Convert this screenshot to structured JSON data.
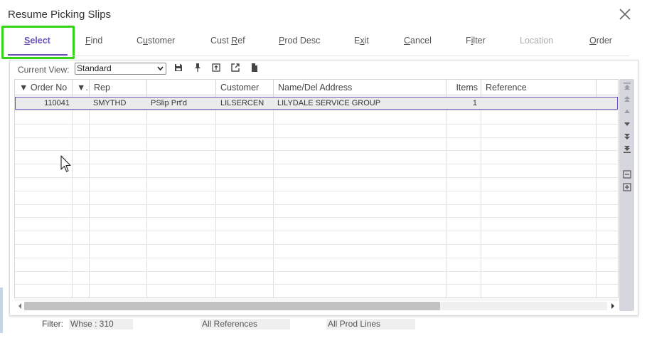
{
  "window": {
    "title": "Resume Picking Slips"
  },
  "toolbar": {
    "buttons": [
      {
        "label": "Select",
        "underline": "S",
        "active": true,
        "enabled": true
      },
      {
        "label": "Find",
        "underline": "F",
        "enabled": true
      },
      {
        "label": "Customer",
        "underline": "u",
        "enabled": true
      },
      {
        "label": "Cust Ref",
        "underline": "R",
        "enabled": true
      },
      {
        "label": "Prod Desc",
        "underline": "P",
        "enabled": true
      },
      {
        "label": "Exit",
        "underline": "x",
        "enabled": true
      },
      {
        "label": "Cancel",
        "underline": "C",
        "enabled": true
      },
      {
        "label": "Filter",
        "underline": "i",
        "enabled": true
      },
      {
        "label": "Location",
        "underline": "",
        "enabled": false
      },
      {
        "label": "Order",
        "underline": "O",
        "enabled": true
      }
    ]
  },
  "view": {
    "label": "Current View:",
    "value": "Standard"
  },
  "view_icons": [
    "save-icon",
    "pin-icon",
    "export-icon",
    "popout-icon",
    "document-icon"
  ],
  "grid": {
    "columns": [
      {
        "key": "order_no",
        "label": "▼ Order No"
      },
      {
        "key": "sort",
        "label": "▼."
      },
      {
        "key": "rep",
        "label": "Rep"
      },
      {
        "key": "status",
        "label": ""
      },
      {
        "key": "customer",
        "label": "Customer"
      },
      {
        "key": "name",
        "label": "Name/Del Address"
      },
      {
        "key": "items",
        "label": "Items"
      },
      {
        "key": "reference",
        "label": "Reference"
      },
      {
        "key": "extra",
        "label": ""
      }
    ],
    "rows": [
      {
        "order_no": "110041",
        "sort": "",
        "rep": "SMYTHD",
        "status": "PSlip Prt'd",
        "customer": "LILSERCEN",
        "name": "LILYDALE SERVICE GROUP",
        "items": "1",
        "reference": "",
        "extra": ""
      }
    ]
  },
  "vertical_nav": [
    "first-page-icon",
    "page-up-icon",
    "row-up-icon",
    "row-down-icon",
    "page-down-icon",
    "last-page-icon",
    "collapse-icon",
    "expand-icon"
  ],
  "footer": {
    "filter_label": "Filter:",
    "warehouse": "Whse : 310",
    "references": "All References",
    "prod_lines": "All Prod Lines"
  },
  "colors": {
    "accent": "#6a50b8",
    "highlight": "#34d418"
  }
}
